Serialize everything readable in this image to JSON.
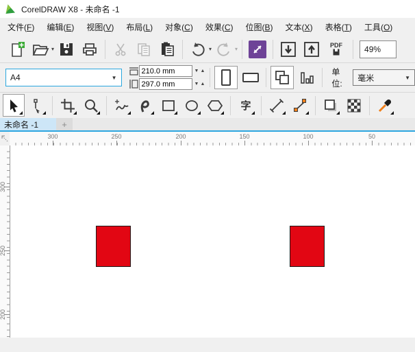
{
  "window": {
    "title": "CorelDRAW X8 - 未命名 -1"
  },
  "menu": {
    "items": [
      {
        "label": "文件",
        "key": "F"
      },
      {
        "label": "编辑",
        "key": "E"
      },
      {
        "label": "视图",
        "key": "V"
      },
      {
        "label": "布局",
        "key": "L"
      },
      {
        "label": "对象",
        "key": "C"
      },
      {
        "label": "效果",
        "key": "C"
      },
      {
        "label": "位图",
        "key": "B"
      },
      {
        "label": "文本",
        "key": "X"
      },
      {
        "label": "表格",
        "key": "T"
      },
      {
        "label": "工具",
        "key": "O"
      }
    ]
  },
  "toolbar": {
    "zoom_level": "49%",
    "pdf_label": "PDF"
  },
  "property_bar": {
    "page_size": "A4",
    "page_width": "210.0 mm",
    "page_height": "297.0 mm",
    "units_label": "单位:",
    "units_value": "毫米"
  },
  "toolbox": {
    "text_tool_glyph": "字"
  },
  "tabs": {
    "active": "未命名 -1",
    "new_tab": "+"
  },
  "rulers": {
    "horizontal": [
      "300",
      "250",
      "200",
      "150",
      "100",
      "50"
    ],
    "vertical": [
      "300",
      "250",
      "200"
    ]
  },
  "canvas": {
    "shapes": [
      {
        "type": "rectangle",
        "fill": "#e20613",
        "stroke": "#1a1a1a"
      },
      {
        "type": "rectangle",
        "fill": "#e20613",
        "stroke": "#1a1a1a"
      }
    ]
  },
  "colors": {
    "accent_blue": "#2da6e0",
    "tab_active": "#cde6f7",
    "launcher_purple": "#6e4397",
    "shape_red": "#e20613",
    "connector_orange": "#ef7f1a"
  }
}
